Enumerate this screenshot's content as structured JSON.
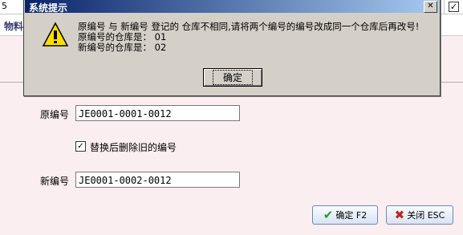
{
  "background": {
    "grid_cell": "5",
    "grid_checkbox": "✓",
    "form_title": "物料",
    "original_code_label": "原编号",
    "original_code_value": "JE0001-0001-0012",
    "replace_delete_checkbox": "✓",
    "replace_delete_label": "替换后删除旧的编号",
    "new_code_label": "新编号",
    "new_code_value": "JE0001-0002-0012",
    "confirm_button": "确定 F2",
    "close_button": "关闭 ESC"
  },
  "dialog": {
    "title": "系统提示",
    "close_glyph": "✕",
    "message_line1": "原编号 与 新编号 登记的 仓库不相同,请将两个编号的编号改成同一个仓库后再改号!",
    "message_line2": "原编号的仓库是： 01",
    "message_line3": "新编号的仓库是： 02",
    "ok_button": "确定"
  }
}
